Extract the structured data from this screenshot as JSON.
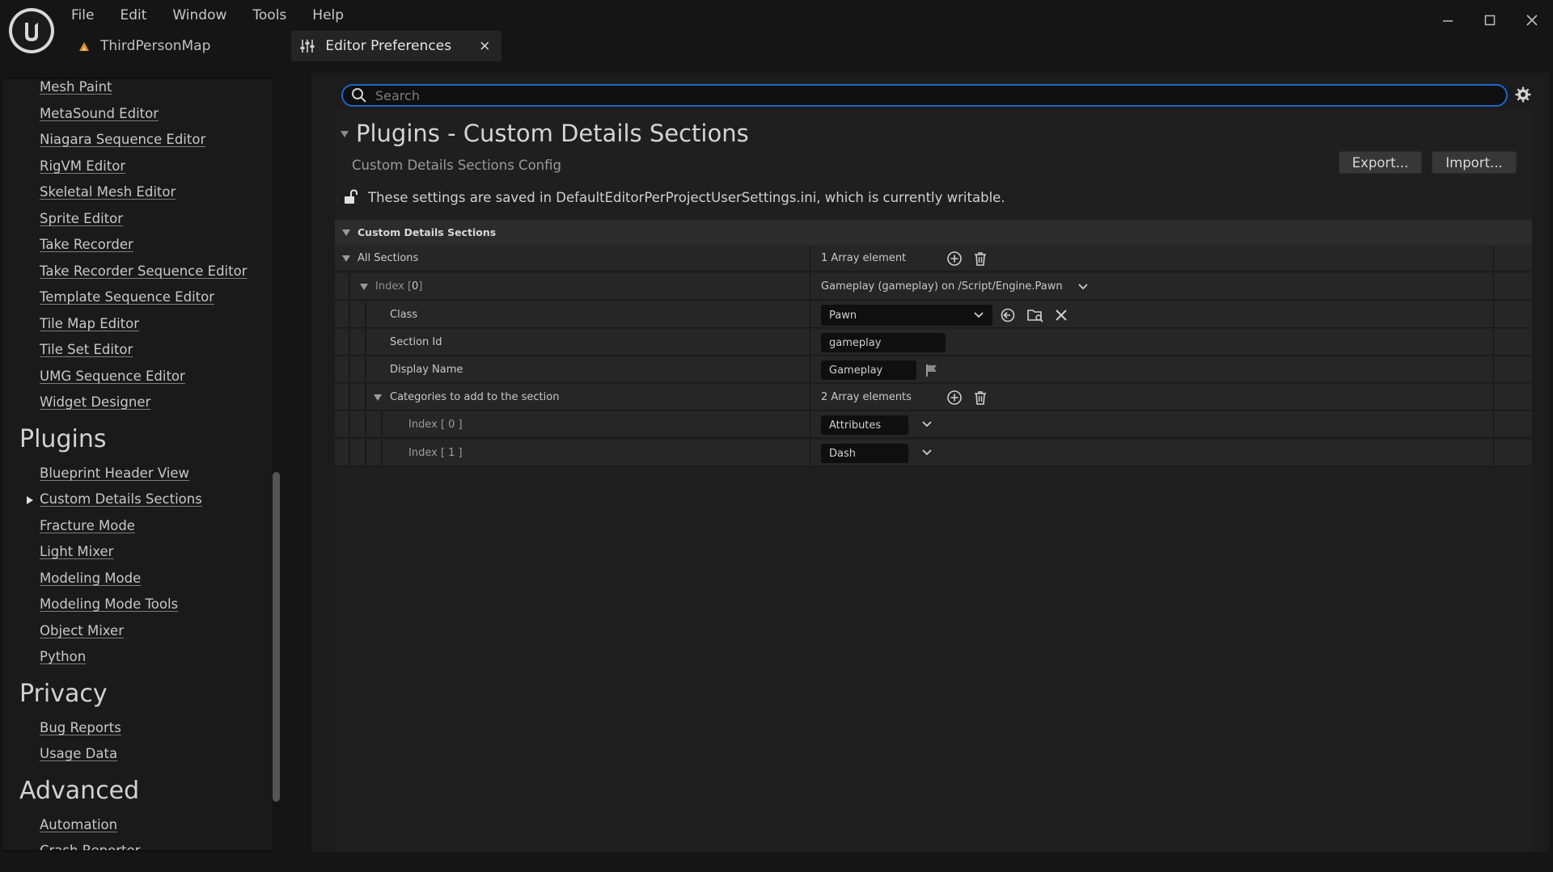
{
  "menubar": {
    "items": [
      "File",
      "Edit",
      "Window",
      "Tools",
      "Help"
    ]
  },
  "tabs": [
    {
      "label": "ThirdPersonMap"
    },
    {
      "label": "Editor Preferences",
      "close": "×"
    }
  ],
  "sidebar": {
    "editor_items": [
      "Mesh Paint",
      "MetaSound Editor",
      "Niagara Sequence Editor",
      "RigVM Editor",
      "Skeletal Mesh Editor",
      "Sprite Editor",
      "Take Recorder",
      "Take Recorder Sequence Editor",
      "Template Sequence Editor",
      "Tile Map Editor",
      "Tile Set Editor",
      "UMG Sequence Editor",
      "Widget Designer"
    ],
    "plugins_heading": "Plugins",
    "plugins_items": [
      "Blueprint Header View",
      "Custom Details Sections",
      "Fracture Mode",
      "Light Mixer",
      "Modeling Mode",
      "Modeling Mode Tools",
      "Object Mixer",
      "Python"
    ],
    "privacy_heading": "Privacy",
    "privacy_items": [
      "Bug Reports",
      "Usage Data"
    ],
    "advanced_heading": "Advanced",
    "advanced_items": [
      "Automation",
      "Crash Reporter"
    ]
  },
  "search": {
    "placeholder": "Search"
  },
  "page": {
    "title": "Plugins - Custom Details Sections",
    "subtitle": "Custom Details Sections Config",
    "export_label": "Export...",
    "import_label": "Import...",
    "writable_msg": "These settings are saved in DefaultEditorPerProjectUserSettings.ini, which is currently writable."
  },
  "details": {
    "category": "Custom Details Sections",
    "all_sections": {
      "label": "All Sections",
      "count": "1 Array element"
    },
    "index0": {
      "label_prefix": "Index [ ",
      "num": "0",
      "label_suffix": " ]",
      "value": "Gameplay (gameplay) on /Script/Engine.Pawn"
    },
    "class_row": {
      "label": "Class",
      "value": "Pawn"
    },
    "section_id": {
      "label": "Section Id",
      "value": "gameplay"
    },
    "display_name": {
      "label": "Display Name",
      "value": "Gameplay"
    },
    "categories": {
      "label": "Categories to add to the section",
      "count": "2 Array elements"
    },
    "cat_index0": {
      "label": "Index [ 0 ]",
      "value": "Attributes"
    },
    "cat_index1": {
      "label": "Index [ 1 ]",
      "value": "Dash"
    }
  },
  "colors": {
    "accent": "#1c66c9",
    "background": "#151515",
    "panel": "#1f1f1f"
  }
}
